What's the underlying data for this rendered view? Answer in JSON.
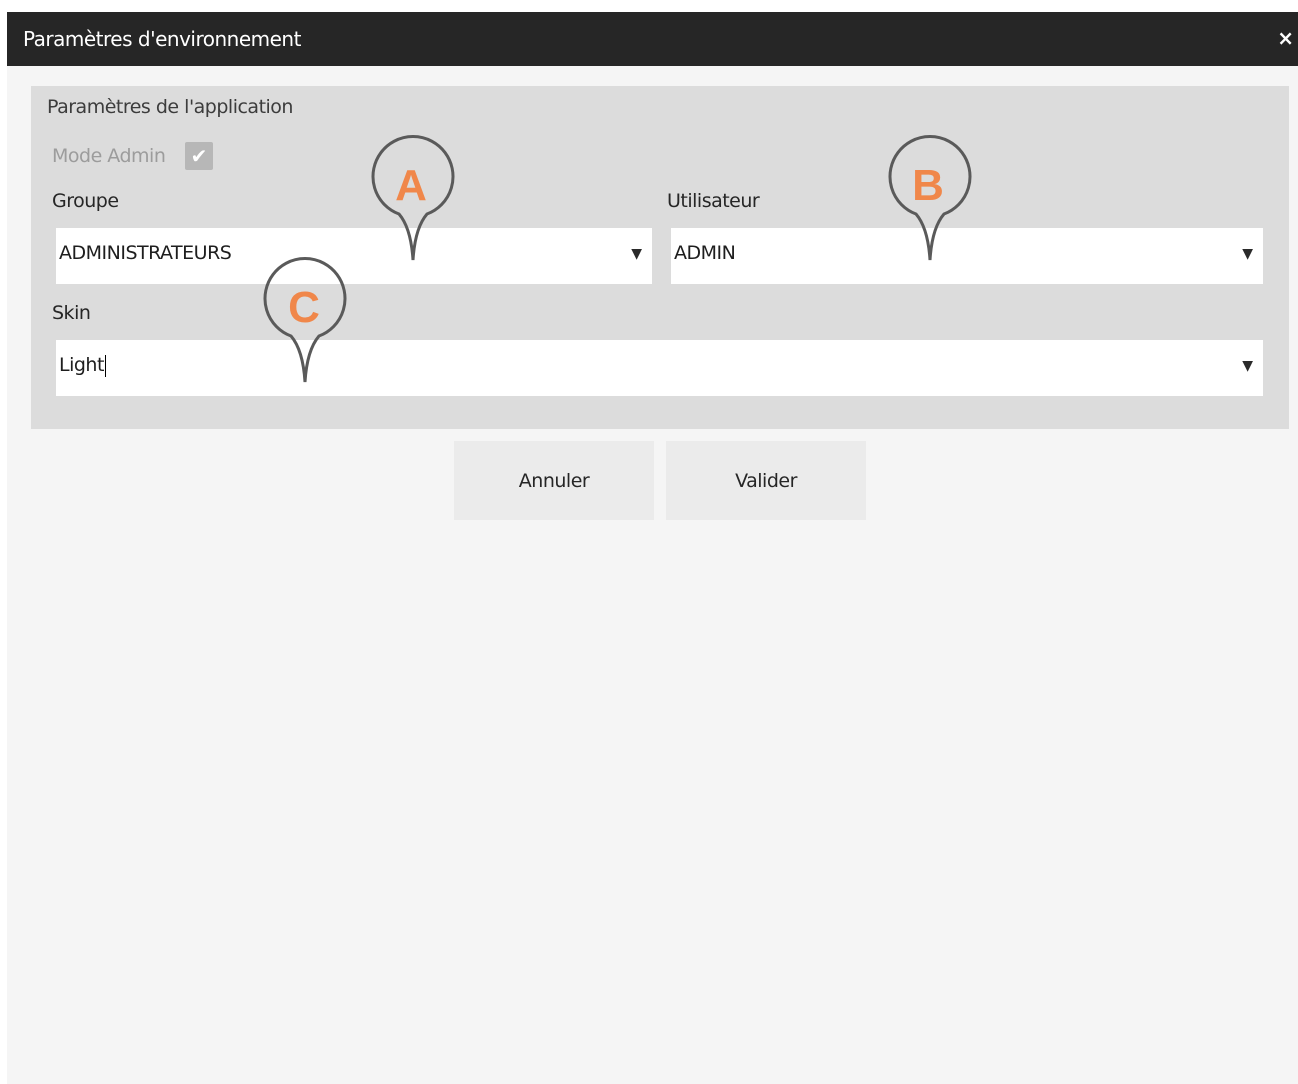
{
  "window": {
    "title": "Paramètres d'environnement",
    "close_label": "×"
  },
  "settings": {
    "group_title": "Paramètres de l'application",
    "admin_mode": {
      "label": "Mode Admin",
      "checked": true,
      "check_glyph": "✔"
    },
    "groupe": {
      "label": "Groupe",
      "value": "ADMINISTRATEURS",
      "arrow": "▼"
    },
    "utilisateur": {
      "label": "Utilisateur",
      "value": "ADMIN",
      "arrow": "▼"
    },
    "skin": {
      "label": "Skin",
      "value": "Light",
      "arrow": "▼"
    }
  },
  "buttons": {
    "cancel_label": "Annuler",
    "validate_label": "Valider"
  },
  "callouts": {
    "a": "A",
    "b": "B",
    "c": "C",
    "color": "#f0874a"
  },
  "colors": {
    "titlebar": "#262626",
    "group_background": "#dcdcdc",
    "window_background": "#f5f5f5"
  }
}
